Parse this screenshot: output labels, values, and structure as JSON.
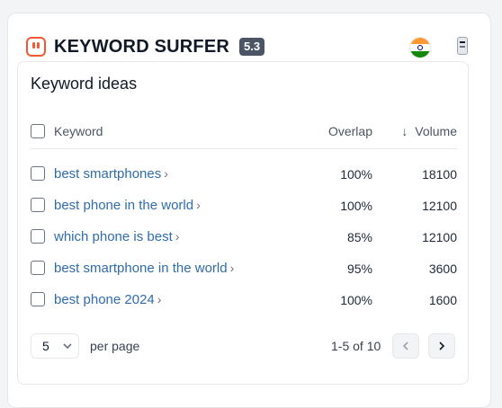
{
  "header": {
    "brand": "KEYWORD SURFER",
    "version": "5.3",
    "icons": [
      "surfer-logo-icon",
      "india-flag-icon",
      "mobile-device-icon"
    ],
    "accent_color": "#ef5a32"
  },
  "card": {
    "title": "Keyword ideas",
    "columns": {
      "keyword": "Keyword",
      "overlap": "Overlap",
      "volume": "Volume",
      "sort_indicator": "↓"
    },
    "rows": [
      {
        "keyword": "best smartphones",
        "overlap": "100%",
        "volume": "18100"
      },
      {
        "keyword": "best phone in the world",
        "overlap": "100%",
        "volume": "12100"
      },
      {
        "keyword": "which phone is best",
        "overlap": "85%",
        "volume": "12100"
      },
      {
        "keyword": "best smartphone in the world",
        "overlap": "95%",
        "volume": "3600"
      },
      {
        "keyword": "best phone 2024",
        "overlap": "100%",
        "volume": "1600"
      }
    ],
    "link_color": "#2f6cad"
  },
  "pagination": {
    "per_page_value": "5",
    "per_page_label": "per page",
    "range": "1-5 of 10"
  }
}
